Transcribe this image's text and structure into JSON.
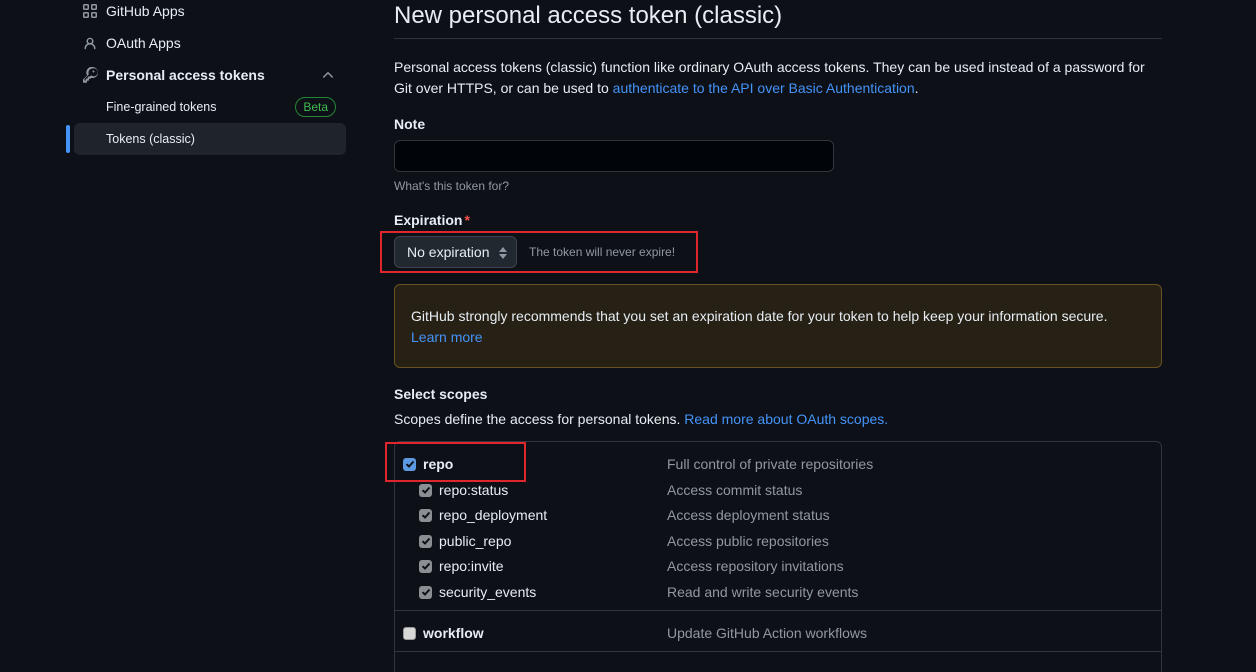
{
  "sidebar": {
    "github_apps": "GitHub Apps",
    "oauth_apps": "OAuth Apps",
    "pat": "Personal access tokens",
    "fine_grained": "Fine-grained tokens",
    "beta": "Beta",
    "classic": "Tokens (classic)"
  },
  "main": {
    "title": "New personal access token (classic)",
    "intro_text": "Personal access tokens (classic) function like ordinary OAuth access tokens. They can be used instead of a password for Git over HTTPS, or can be used to ",
    "intro_link": "authenticate to the API over Basic Authentication",
    "intro_end": ".",
    "note_label": "Note",
    "note_value": "",
    "note_hint": "What's this token for?",
    "expiration_label": "Expiration",
    "required_mark": "*",
    "expiration_value": "No expiration",
    "expiration_note": "The token will never expire!",
    "warning_text": "GitHub strongly recommends that you set an expiration date for your token to help keep your information secure.",
    "warning_link": "Learn more",
    "scopes_title": "Select scopes",
    "scopes_desc": "Scopes define the access for personal tokens. ",
    "scopes_link": "Read more about OAuth scopes."
  },
  "scopes": [
    {
      "name": "repo",
      "desc": "Full control of private repositories",
      "checked": true
    },
    {
      "name": "repo:status",
      "desc": "Access commit status",
      "checked": true
    },
    {
      "name": "repo_deployment",
      "desc": "Access deployment status",
      "checked": true
    },
    {
      "name": "public_repo",
      "desc": "Access public repositories",
      "checked": true
    },
    {
      "name": "repo:invite",
      "desc": "Access repository invitations",
      "checked": true
    },
    {
      "name": "security_events",
      "desc": "Read and write security events",
      "checked": true
    },
    {
      "name": "workflow",
      "desc": "Update GitHub Action workflows",
      "checked": false
    }
  ],
  "colors": {
    "accent": "#4493f8",
    "highlight": "#e0262d",
    "badge": "#3fb950",
    "warning_bg": "#272115"
  }
}
